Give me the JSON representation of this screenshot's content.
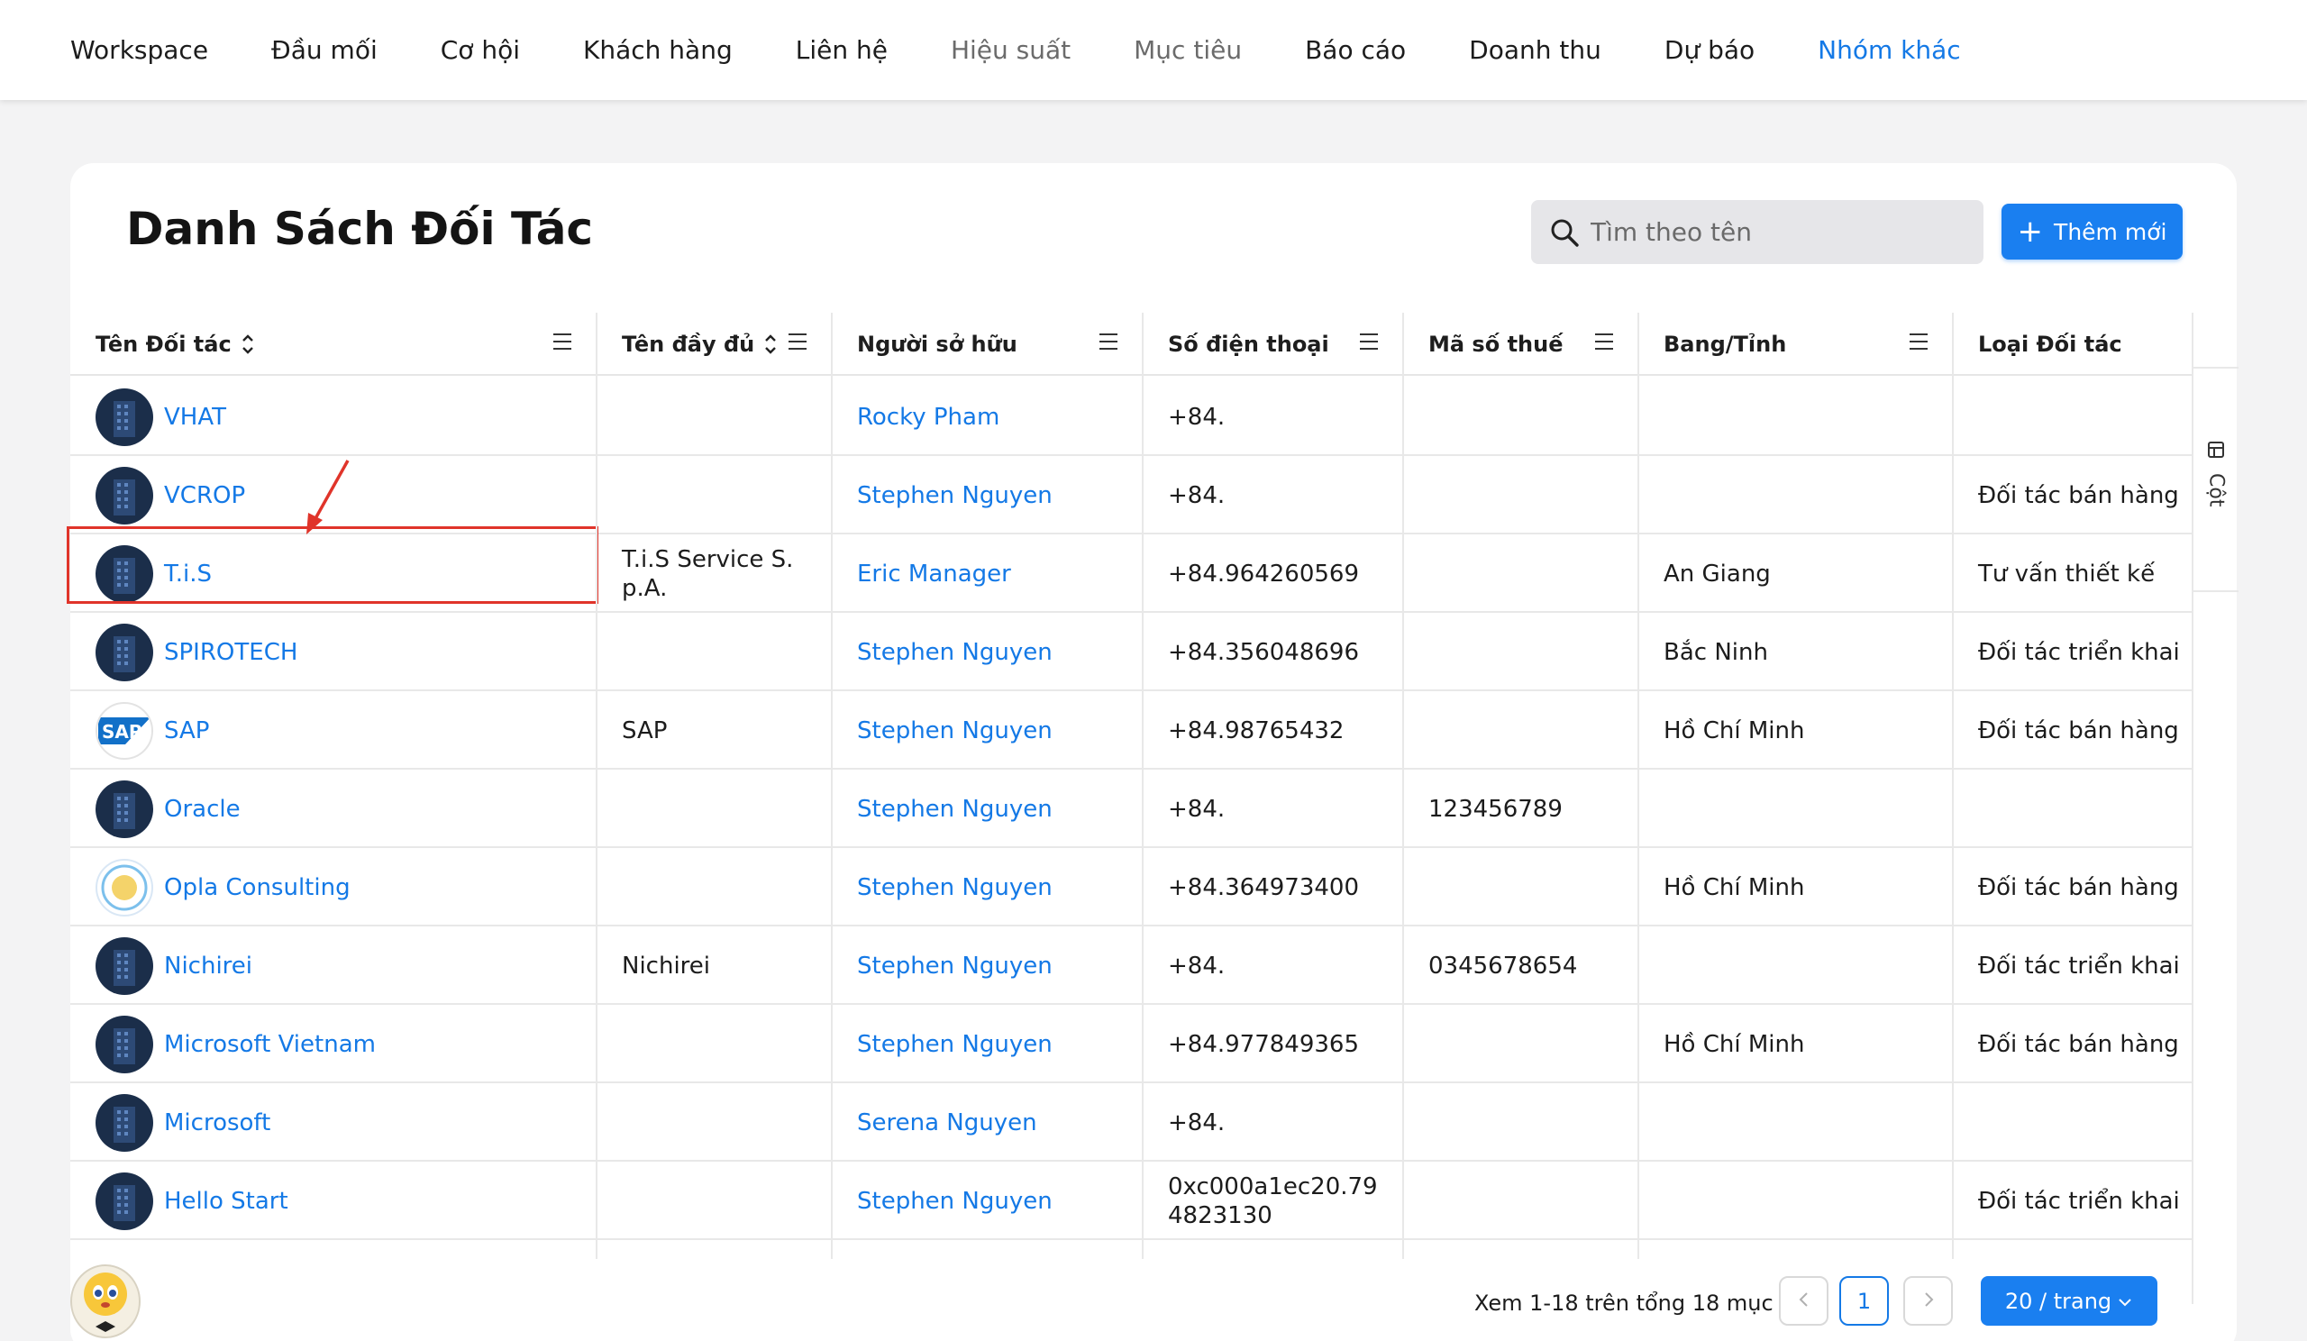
{
  "nav": {
    "items": [
      {
        "label": "Workspace",
        "state": "normal"
      },
      {
        "label": "Đầu mối",
        "state": "normal"
      },
      {
        "label": "Cơ hội",
        "state": "normal"
      },
      {
        "label": "Khách hàng",
        "state": "normal"
      },
      {
        "label": "Liên hệ",
        "state": "normal"
      },
      {
        "label": "Hiệu suất",
        "state": "muted"
      },
      {
        "label": "Mục tiêu",
        "state": "muted"
      },
      {
        "label": "Báo cáo",
        "state": "normal"
      },
      {
        "label": "Doanh thu",
        "state": "normal"
      },
      {
        "label": "Dự báo",
        "state": "normal"
      },
      {
        "label": "Nhóm khác",
        "state": "active"
      }
    ]
  },
  "page": {
    "title": "Danh Sách Đối Tác",
    "search_placeholder": "Tìm theo tên",
    "add_label": "Thêm mới"
  },
  "table": {
    "columns": [
      "Tên Đối tác",
      "Tên đầy đủ",
      "Người sở hữu",
      "Số điện thoại",
      "Mã số thuế",
      "Bang/Tỉnh",
      "Loại Đối tác"
    ],
    "rows": [
      {
        "name": "VHAT",
        "full_name": "",
        "owner": "Rocky Pham",
        "phone": "+84.",
        "tax": "",
        "province": "",
        "type": "",
        "avatar": "building-icon"
      },
      {
        "name": "VCROP",
        "full_name": "",
        "owner": "Stephen Nguyen",
        "phone": "+84.",
        "tax": "",
        "province": "",
        "type": "Đối tác bán hàng",
        "avatar": "building-icon"
      },
      {
        "name": "T.i.S",
        "full_name": "T.i.S Service S.p.A.",
        "owner": "Eric Manager",
        "phone": "+84.964260569",
        "tax": "",
        "province": "An Giang",
        "type": "Tư vấn thiết kế",
        "avatar": "building-icon"
      },
      {
        "name": "SPIROTECH",
        "full_name": "",
        "owner": "Stephen Nguyen",
        "phone": "+84.356048696",
        "tax": "",
        "province": "Bắc Ninh",
        "type": "Đối tác triển khai",
        "avatar": "building-icon"
      },
      {
        "name": "SAP",
        "full_name": "SAP",
        "owner": "Stephen Nguyen",
        "phone": "+84.98765432",
        "tax": "",
        "province": "Hồ Chí Minh",
        "type": "Đối tác bán hàng",
        "avatar": "sap-logo"
      },
      {
        "name": "Oracle",
        "full_name": "",
        "owner": "Stephen Nguyen",
        "phone": "+84.",
        "tax": "123456789",
        "province": "",
        "type": "",
        "avatar": "building-icon"
      },
      {
        "name": "Opla Consulting",
        "full_name": "",
        "owner": "Stephen Nguyen",
        "phone": "+84.364973400",
        "tax": "",
        "province": "Hồ Chí Minh",
        "type": "Đối tác bán hàng",
        "avatar": "opla-logo"
      },
      {
        "name": "Nichirei",
        "full_name": "Nichirei",
        "owner": "Stephen Nguyen",
        "phone": "+84.",
        "tax": "0345678654",
        "province": "",
        "type": "Đối tác triển khai",
        "avatar": "building-icon"
      },
      {
        "name": "Microsoft Vietnam",
        "full_name": "",
        "owner": "Stephen Nguyen",
        "phone": "+84.977849365",
        "tax": "",
        "province": "Hồ Chí Minh",
        "type": "Đối tác bán hàng",
        "avatar": "building-icon"
      },
      {
        "name": "Microsoft",
        "full_name": "",
        "owner": "Serena Nguyen",
        "phone": "+84.",
        "tax": "",
        "province": "",
        "type": "",
        "avatar": "building-icon"
      },
      {
        "name": "Hello Start",
        "full_name": "",
        "owner": "Stephen Nguyen",
        "phone": "0xc000a1ec20.794823130",
        "tax": "",
        "province": "",
        "type": "Đối tác triển khai",
        "avatar": "building-icon"
      }
    ]
  },
  "side_panel": {
    "label": "Cột",
    "icon": "columns-icon"
  },
  "footer": {
    "summary": "Xem 1-18 trên tổng 18 mục",
    "current_page": "1",
    "page_size": "20 / trang"
  },
  "colors": {
    "accent": "#1479e6",
    "button": "#1a7ff0",
    "highlight": "#e0342a"
  }
}
